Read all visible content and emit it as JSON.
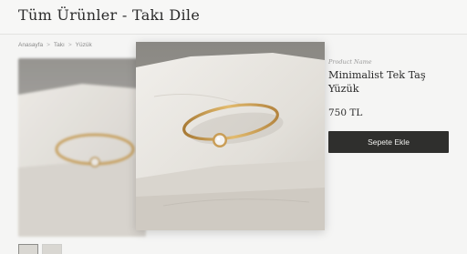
{
  "header": {
    "site_title": "Tüm Ürünler - Takı Dile"
  },
  "breadcrumb": {
    "items": [
      "Anasayfa",
      "Takı",
      "Yüzük"
    ],
    "separator": ">"
  },
  "product": {
    "label": "Product Name",
    "name": "Minimalist Tek Taş Yüzük",
    "price": "750 TL",
    "add_to_cart_label": "Sepete Ekle"
  },
  "colors": {
    "button_bg": "#2f2f2d",
    "ring_gold": "#c89a52",
    "stone_marble": "#dcd9d3"
  }
}
